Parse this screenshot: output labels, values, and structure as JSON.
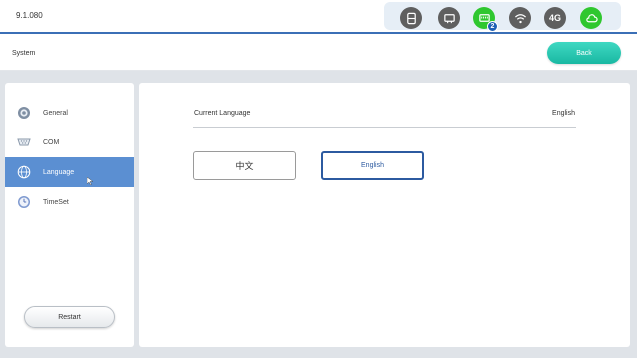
{
  "app": {
    "version": "9.1.080"
  },
  "status_bar": {
    "icons": [
      "sim-card-icon",
      "ethernet-icon",
      "lan-port-icon",
      "wifi-icon",
      "4g-icon",
      "cloud-icon"
    ],
    "lan_badge": "2",
    "fourg_text": "4G",
    "colors": {
      "active": "#2fc72f",
      "inactive": "#5f5f5f",
      "badge": "#1e5fb5"
    }
  },
  "header": {
    "title": "System",
    "back_label": "Back"
  },
  "sidebar": {
    "items": [
      {
        "label": "General",
        "icon": "gear-icon"
      },
      {
        "label": "COM",
        "icon": "serial-port-icon"
      },
      {
        "label": "Language",
        "icon": "globe-icon",
        "active": true
      },
      {
        "label": "TimeSet",
        "icon": "clock-icon"
      }
    ],
    "restart_label": "Restart"
  },
  "content": {
    "current_language_label": "Current Language",
    "current_language_value": "English",
    "options": [
      "中文",
      "English"
    ]
  },
  "colors": {
    "accent": "#3b6fb6",
    "back_button": "#19b8a2",
    "active_menu": "#5b8fd2",
    "selected_option": "#2c5aa0"
  }
}
